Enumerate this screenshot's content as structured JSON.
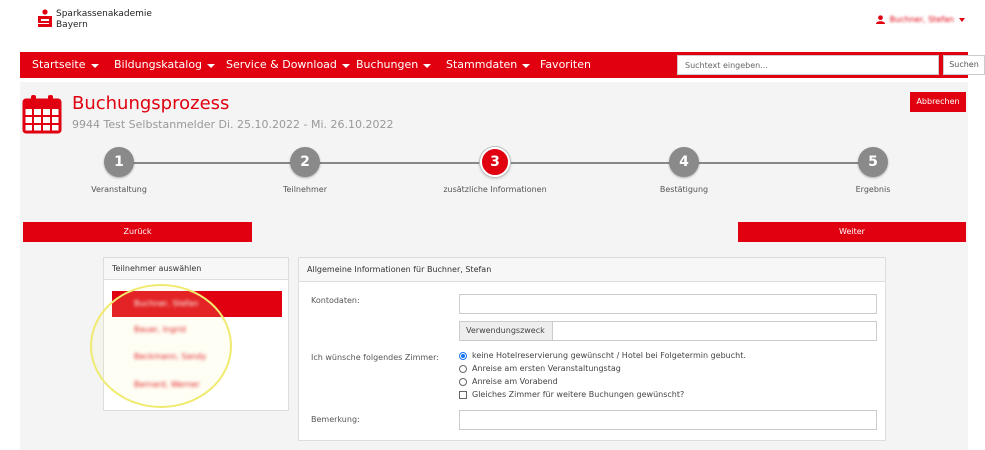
{
  "brand": {
    "line1": "Sparkassenakademie",
    "line2": "Bayern",
    "color": "#e0000f"
  },
  "user": {
    "name": "Buchner, Stefan",
    "icon": "user-icon"
  },
  "nav": {
    "items": [
      {
        "label": "Startseite",
        "dropdown": true
      },
      {
        "label": "Bildungskatalog",
        "dropdown": true
      },
      {
        "label": "Service & Download",
        "dropdown": true
      },
      {
        "label": "Buchungen",
        "dropdown": true
      },
      {
        "label": "Stammdaten",
        "dropdown": true
      },
      {
        "label": "Favoriten",
        "dropdown": false
      }
    ],
    "search_placeholder": "Suchtext eingeben...",
    "search_button": "Suchen"
  },
  "page": {
    "title": "Buchungsprozess",
    "subtitle": "9944 Test Selbstanmelder Di. 25.10.2022 - Mi. 26.10.2022",
    "cancel_label": "Abbrechen",
    "icon": "calendar-icon"
  },
  "steps": [
    {
      "number": "1",
      "label": "Veranstaltung"
    },
    {
      "number": "2",
      "label": "Teilnehmer"
    },
    {
      "number": "3",
      "label": "zusätzliche Informationen"
    },
    {
      "number": "4",
      "label": "Bestätigung"
    },
    {
      "number": "5",
      "label": "Ergebnis"
    }
  ],
  "active_step": 3,
  "buttons": {
    "back": "Zurück",
    "next": "Weiter"
  },
  "participants": {
    "title": "Teilnehmer auswählen",
    "items": [
      {
        "name": "Buchner, Stefan",
        "active": true
      },
      {
        "name": "Bauer, Ingrid",
        "active": false
      },
      {
        "name": "Beckmann, Sandy",
        "active": false
      },
      {
        "name": "Bernard, Werner",
        "active": false
      }
    ]
  },
  "form": {
    "title": "Allgemeine Informationen für Buchner, Stefan",
    "kontodaten_label": "Kontodaten:",
    "kontodaten_value": "",
    "verwendungszweck_label": "Verwendungszweck",
    "verwendungszweck_value": "",
    "zimmer_label": "Ich wünsche folgendes Zimmer:",
    "zimmer_options": [
      {
        "label": "keine Hotelreservierung gewünscht / Hotel bei Folgetermin gebucht.",
        "selected": true
      },
      {
        "label": "Anreise am ersten Veranstaltungstag",
        "selected": false
      },
      {
        "label": "Anreise am Vorabend",
        "selected": false
      }
    ],
    "same_room_label": "Gleiches Zimmer für weitere Buchungen gewünscht?",
    "same_room_checked": false,
    "bemerkung_label": "Bemerkung:",
    "bemerkung_value": ""
  }
}
